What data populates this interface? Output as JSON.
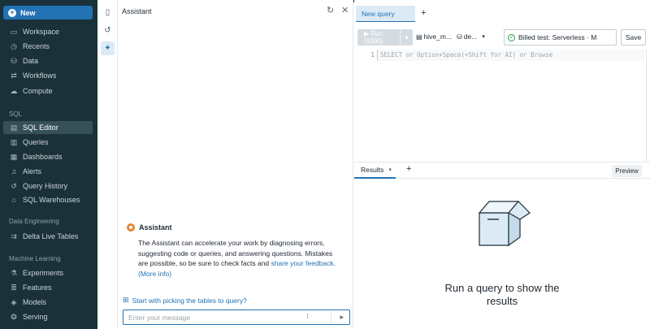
{
  "nav": {
    "new_label": "New",
    "items_top": [
      {
        "label": "Workspace",
        "icon": "folder-icon"
      },
      {
        "label": "Recents",
        "icon": "clock-icon"
      },
      {
        "label": "Data",
        "icon": "data-icon"
      },
      {
        "label": "Workflows",
        "icon": "workflows-icon"
      },
      {
        "label": "Compute",
        "icon": "cloud-icon"
      }
    ],
    "sql_section": "SQL",
    "items_sql": [
      {
        "label": "SQL Editor",
        "icon": "editor-icon",
        "active": true
      },
      {
        "label": "Queries",
        "icon": "queries-icon"
      },
      {
        "label": "Dashboards",
        "icon": "dashboard-icon"
      },
      {
        "label": "Alerts",
        "icon": "bell-icon"
      },
      {
        "label": "Query History",
        "icon": "history-icon"
      },
      {
        "label": "SQL Warehouses",
        "icon": "warehouse-icon"
      }
    ],
    "de_section": "Data Engineering",
    "items_de": [
      {
        "label": "Delta Live Tables",
        "icon": "pipeline-icon"
      }
    ],
    "ml_section": "Machine Learning",
    "items_ml": [
      {
        "label": "Experiments",
        "icon": "flask-icon"
      },
      {
        "label": "Features",
        "icon": "features-icon"
      },
      {
        "label": "Models",
        "icon": "models-icon"
      },
      {
        "label": "Serving",
        "icon": "serving-icon"
      }
    ]
  },
  "assistant": {
    "title": "Assistant",
    "name": "Assistant",
    "body_text": "The Assistant can accelerate your work by diagnosing errors, suggesting code or queries, and answering questions. Mistakes are possible, so be sure to check facts and ",
    "feedback_link": "share your feedback",
    "more_info_link": "(More info)",
    "tables_prompt": "Start with picking the tables to query?",
    "input_placeholder": "Enter your message"
  },
  "editor": {
    "tab_label": "New query",
    "run_label": "▶ Run (1000)",
    "catalog": "hive_m...",
    "schema": "de...",
    "warehouse": "Billed test: Serverless · M",
    "save_label": "Save",
    "line_number": "1",
    "placeholder_code": "SELECT or Option+Space(+Shift for AI) or Browse",
    "results_tab": "Results",
    "preview_label": "Preview",
    "empty_message": "Run a query to show the results"
  },
  "colors": {
    "nav_bg": "#1b3139",
    "accent": "#2272b4",
    "assistant_avatar": "#e5832d",
    "status_ok": "#2d9b47"
  }
}
